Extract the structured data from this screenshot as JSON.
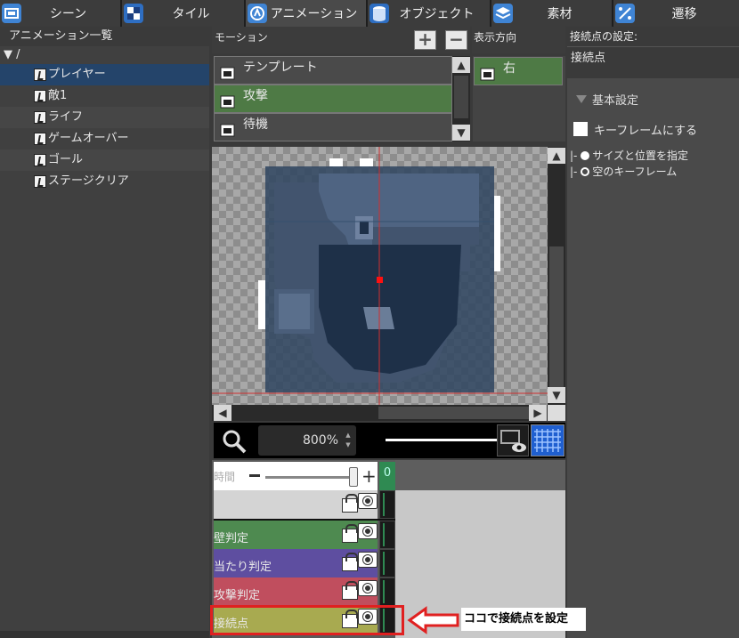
{
  "tabs": [
    {
      "label": "シーン",
      "icon": "scene-icon",
      "color": "#4a8fd8"
    },
    {
      "label": "タイル",
      "icon": "tile-icon",
      "color": "#3a70c0"
    },
    {
      "label": "アニメーション",
      "icon": "animation-icon",
      "color": "#4a8fd8"
    },
    {
      "label": "オブジェクト",
      "icon": "object-icon",
      "color": "#3a70c0"
    },
    {
      "label": "素材",
      "icon": "material-icon",
      "color": "#4a8fd8"
    },
    {
      "label": "遷移",
      "icon": "transition-icon",
      "color": "#4a8fd8"
    }
  ],
  "left_panel": {
    "title": "アニメーション一覧",
    "root": "▼ /",
    "items": [
      "プレイヤー",
      "敵1",
      "ライフ",
      "ゲームオーバー",
      "ゴール",
      "ステージクリア"
    ]
  },
  "motion": {
    "title": "モーション",
    "add_label": "+",
    "remove_label": "−",
    "items": [
      "テンプレート",
      "攻撃",
      "待機"
    ]
  },
  "direction": {
    "title": "表示方向",
    "items": [
      "右"
    ]
  },
  "zoom": {
    "value": "800%"
  },
  "timeline": {
    "time_label": "時間",
    "frame_number": "0",
    "layers": [
      {
        "name": "",
        "color": "#d4d4d4"
      },
      {
        "name": "壁判定",
        "color": "#4e8a50"
      },
      {
        "name": "当たり判定",
        "color": "#5e4ea0"
      },
      {
        "name": "攻撃判定",
        "color": "#c04e5e"
      },
      {
        "name": "接続点",
        "color": "#a8aa50"
      }
    ]
  },
  "right_panel": {
    "header": "接続点の設定:",
    "field_value": "接続点",
    "section": "基本設定",
    "checkbox_label": "キーフレームにする",
    "radio_prefix": "|-",
    "radio_1": "サイズと位置を指定",
    "radio_2": "空のキーフレーム"
  },
  "annotation": {
    "text": "ココで接続点を設定",
    "color": "#e02020"
  }
}
